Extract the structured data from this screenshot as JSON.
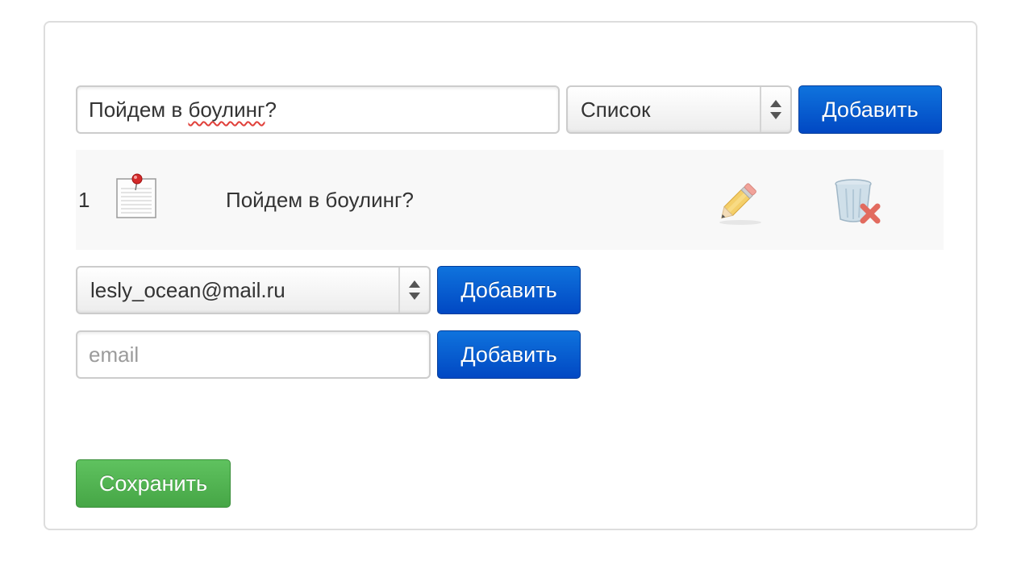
{
  "new_item": {
    "title_value": "Пойдем в ",
    "title_value_misspelled": "боулинг",
    "title_value_tail": "?",
    "type_selected": "Список",
    "add_label": "Добавить"
  },
  "items": [
    {
      "number": "1",
      "icon": "notepad-pin-icon",
      "title": "Пойдем в боулинг?",
      "edit_icon": "pencil-icon",
      "delete_icon": "trash-delete-icon"
    }
  ],
  "share": {
    "contact_selected": "lesly_ocean@mail.ru",
    "contact_add_label": "Добавить",
    "email_placeholder": "email",
    "email_value": "",
    "email_add_label": "Добавить"
  },
  "footer": {
    "save_label": "Сохранить"
  },
  "colors": {
    "primary": "#0148c3",
    "success": "#46a646",
    "row_bg": "#f8f8f8",
    "border": "#cccccc"
  }
}
